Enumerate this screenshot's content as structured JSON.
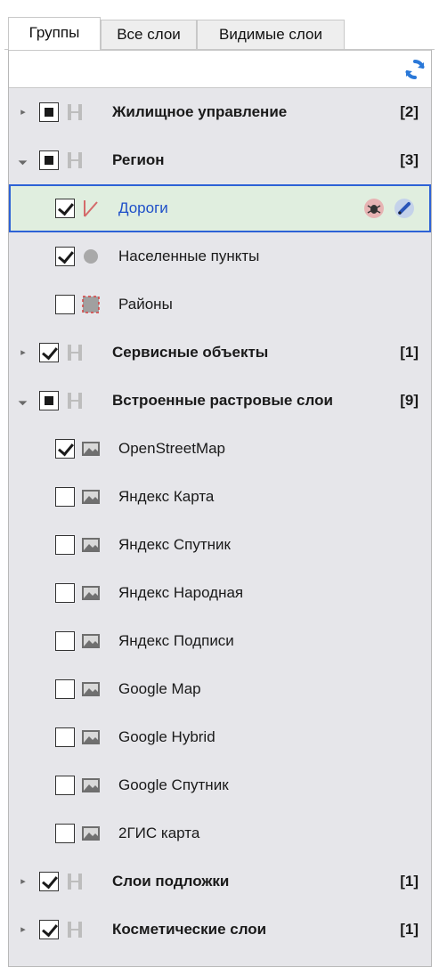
{
  "tabs": [
    {
      "label": "Группы",
      "active": true
    },
    {
      "label": "Все слои",
      "active": false
    },
    {
      "label": "Видимые слои",
      "active": false
    }
  ],
  "toolbar": {
    "refresh_icon": "refresh-icon"
  },
  "tree": [
    {
      "kind": "group",
      "label": "Жилищное управление",
      "count": "[2]",
      "expanded": false,
      "check": "partial"
    },
    {
      "kind": "group",
      "label": "Регион",
      "count": "[3]",
      "expanded": true,
      "check": "partial"
    },
    {
      "kind": "layer",
      "label": "Дороги",
      "check": "checked",
      "icon": "line-layer-icon",
      "selected": true,
      "actions": [
        "bug-icon",
        "edit-pen-icon"
      ]
    },
    {
      "kind": "layer",
      "label": "Населенные пункты",
      "check": "checked",
      "icon": "point-layer-icon"
    },
    {
      "kind": "layer",
      "label": "Районы",
      "check": "unchecked",
      "icon": "polygon-layer-icon"
    },
    {
      "kind": "group",
      "label": "Сервисные объекты",
      "count": "[1]",
      "expanded": false,
      "check": "checked"
    },
    {
      "kind": "group",
      "label": "Встроенные растровые слои",
      "count": "[9]",
      "expanded": true,
      "check": "partial"
    },
    {
      "kind": "layer",
      "label": "OpenStreetMap",
      "check": "checked",
      "icon": "raster-layer-icon"
    },
    {
      "kind": "layer",
      "label": "Яндекс Карта",
      "check": "unchecked",
      "icon": "raster-layer-icon"
    },
    {
      "kind": "layer",
      "label": "Яндекс Спутник",
      "check": "unchecked",
      "icon": "raster-layer-icon"
    },
    {
      "kind": "layer",
      "label": "Яндекс Народная",
      "check": "unchecked",
      "icon": "raster-layer-icon"
    },
    {
      "kind": "layer",
      "label": "Яндекс Подписи",
      "check": "unchecked",
      "icon": "raster-layer-icon"
    },
    {
      "kind": "layer",
      "label": "Google Map",
      "check": "unchecked",
      "icon": "raster-layer-icon"
    },
    {
      "kind": "layer",
      "label": "Google Hybrid",
      "check": "unchecked",
      "icon": "raster-layer-icon"
    },
    {
      "kind": "layer",
      "label": "Google Спутник",
      "check": "unchecked",
      "icon": "raster-layer-icon"
    },
    {
      "kind": "layer",
      "label": "2ГИС карта",
      "check": "unchecked",
      "icon": "raster-layer-icon"
    },
    {
      "kind": "group",
      "label": "Слои подложки",
      "count": "[1]",
      "expanded": false,
      "check": "checked"
    },
    {
      "kind": "group",
      "label": "Косметические слои",
      "count": "[1]",
      "expanded": false,
      "check": "checked"
    }
  ]
}
